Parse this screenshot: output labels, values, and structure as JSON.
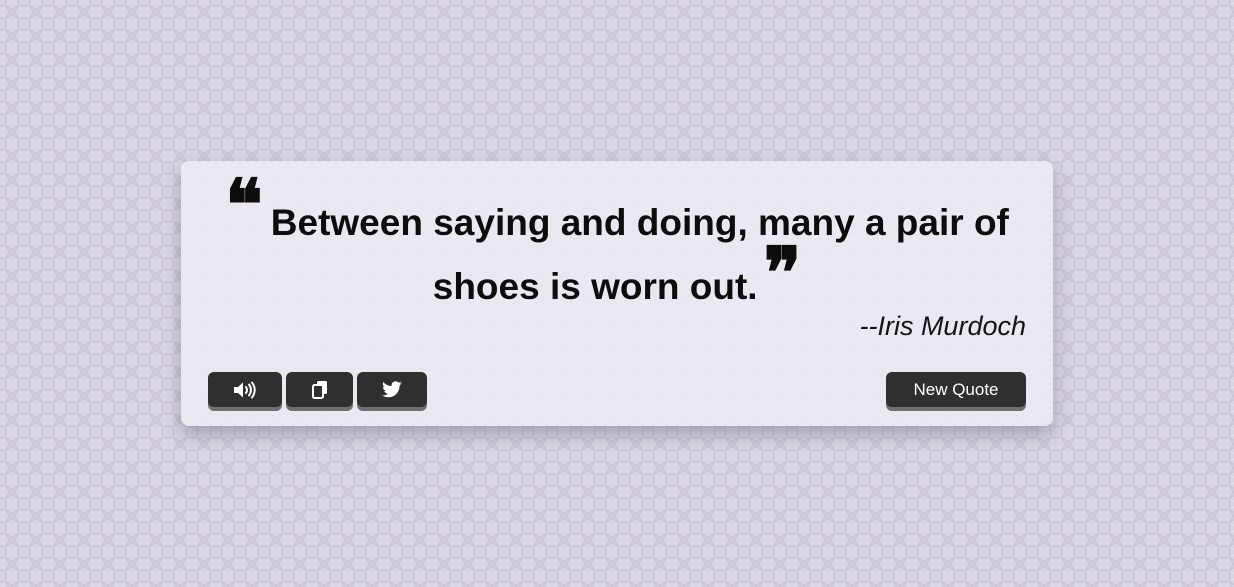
{
  "quote": {
    "text": "Between saying and doing, many a pair of shoes is worn out.",
    "open_mark": "❝",
    "close_mark": "❞",
    "author": "--Iris Murdoch"
  },
  "actions": {
    "speak_icon": "volume-icon",
    "copy_icon": "copy-icon",
    "tweet_icon": "twitter-icon",
    "new_quote_label": "New Quote"
  },
  "colors": {
    "button_bg": "#2f2f2f",
    "text": "#0d0d0d",
    "card_bg": "#eeebf3",
    "page_bg": "#d8d4e1"
  }
}
